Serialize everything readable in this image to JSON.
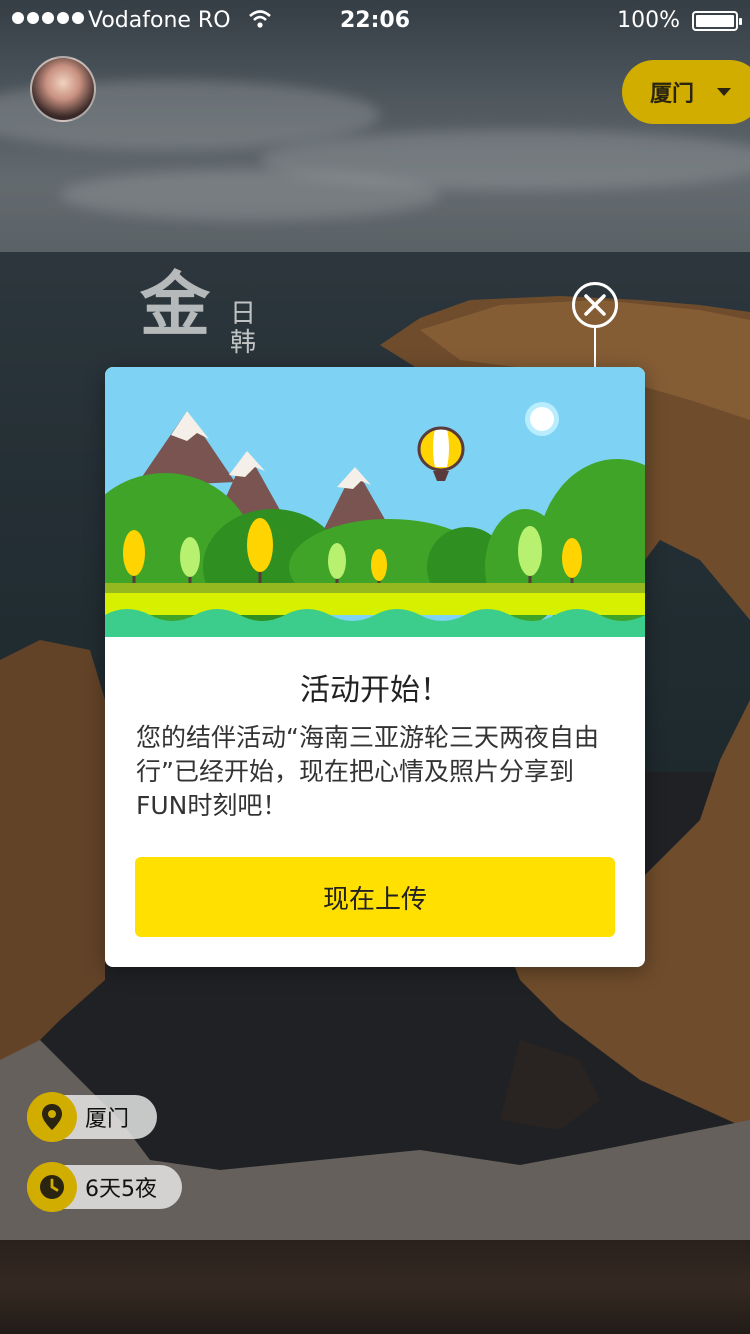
{
  "status_bar": {
    "carrier": "Vodafone RO",
    "time": "22:06",
    "battery": "100%"
  },
  "header": {
    "city_selector": "厦门"
  },
  "background": {
    "title_fragment": "金",
    "subtitle_fragment": "日韩"
  },
  "modal": {
    "title": "活动开始！",
    "body": "您的结伴活动“海南三亚游轮三天两夜自由行”已经开始，现在把心情及照片分享到FUN时刻吧！",
    "upload_button": "现在上传"
  },
  "info_chips": {
    "location": "厦门",
    "duration": "6天5夜"
  },
  "colors": {
    "accent_yellow": "#ffe000",
    "chip_yellow": "#d1ad00",
    "sky_blue": "#7ed3f4",
    "grass_green": "#3a9a2a"
  },
  "icons": [
    "wifi-icon",
    "battery-icon",
    "caret-down-icon",
    "close-icon",
    "location-pin-icon",
    "clock-icon",
    "hot-air-balloon-icon",
    "sun-icon"
  ]
}
